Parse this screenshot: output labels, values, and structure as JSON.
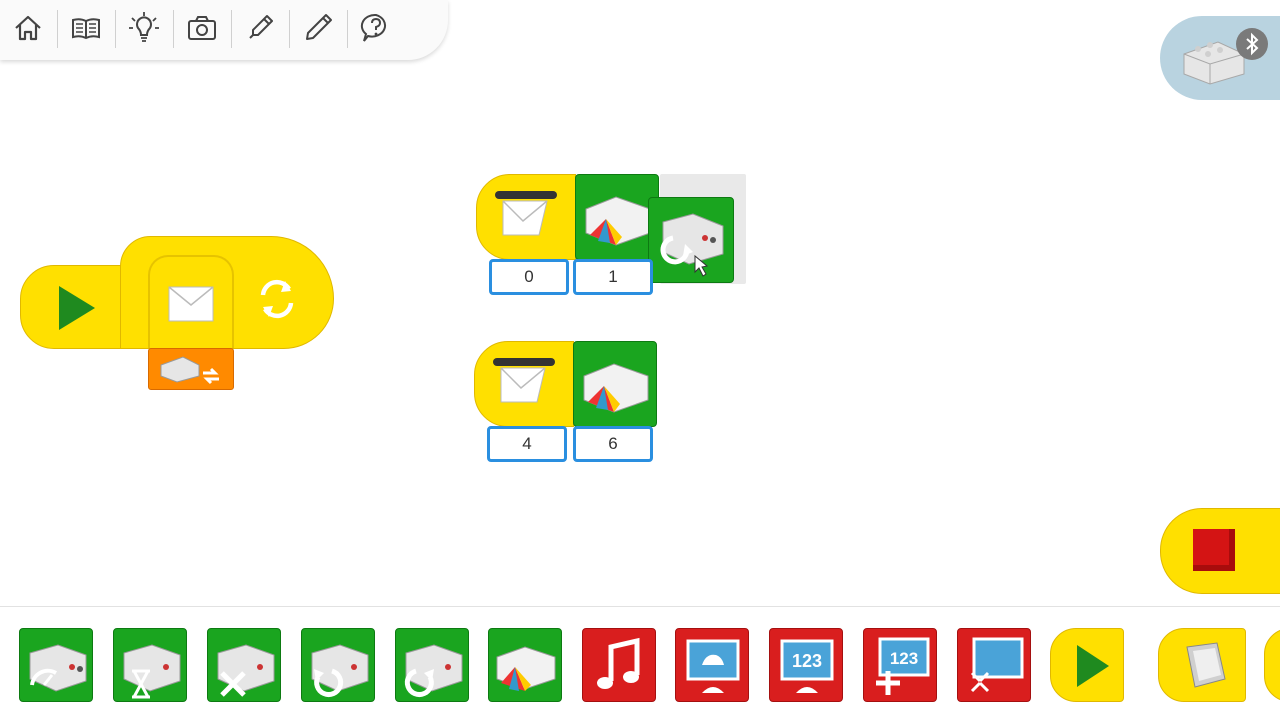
{
  "toolbar": {
    "items": [
      "home-icon",
      "book-icon",
      "lightbulb-icon",
      "camera-icon",
      "dropper-pen-icon",
      "pencil-icon",
      "help-icon"
    ]
  },
  "hub": {
    "icon": "bluetooth-icon"
  },
  "canvas": {
    "row1_inputs": [
      "0",
      "1"
    ],
    "row2_inputs": [
      "4",
      "6"
    ]
  },
  "colors": {
    "yellow": "#ffe000",
    "green": "#1aa51f",
    "red": "#d91e1e",
    "orange": "#ff8a00",
    "input_border": "#2a8fe0"
  },
  "palette": {
    "items": [
      "motor-power-block",
      "motor-on-for-block",
      "motor-off-block",
      "motor-counterclockwise-block",
      "motor-clockwise-block",
      "hub-light-block",
      "play-sound-block",
      "display-background-block",
      "display-number-block",
      "add-to-display-block",
      "display-size-block",
      "start-block",
      "key-press-block"
    ]
  }
}
